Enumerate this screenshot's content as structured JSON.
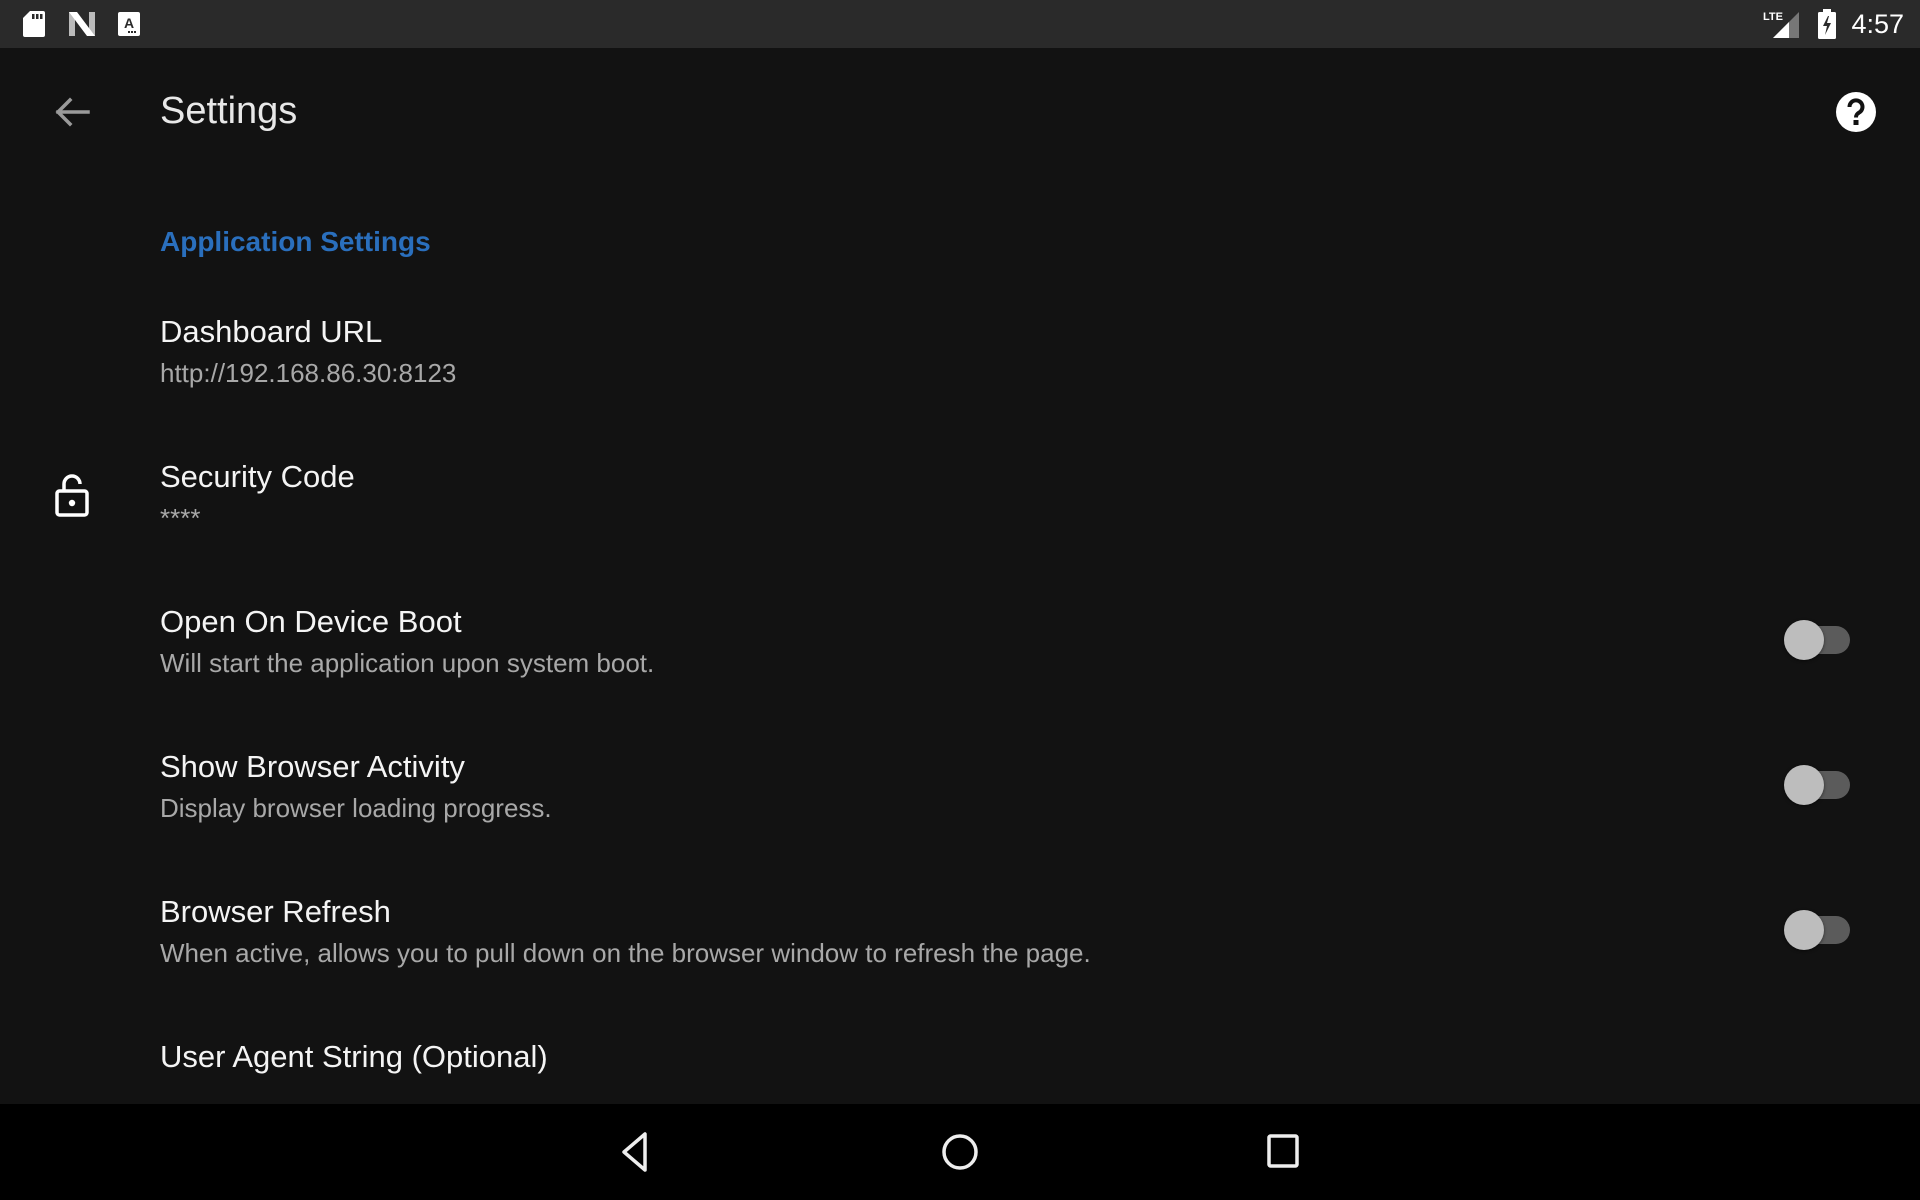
{
  "status_bar": {
    "left_icons": [
      "sd-card-icon",
      "nova-launcher-icon",
      "accessibility-a-icon"
    ],
    "network_label": "LTE",
    "right_icons": [
      "lte-signal-icon",
      "battery-charging-icon"
    ],
    "time": "4:57"
  },
  "app_bar": {
    "back_icon": "arrow-back-icon",
    "title": "Settings",
    "help_icon": "help-circle-icon"
  },
  "section": {
    "title": "Application Settings",
    "accent_color": "#2a6fbd"
  },
  "settings": [
    {
      "id": "dashboard-url",
      "title": "Dashboard URL",
      "summary": "http://192.168.86.30:8123",
      "icon": null,
      "toggle": null
    },
    {
      "id": "security-code",
      "title": "Security Code",
      "summary": "****",
      "icon": "lock-open-icon",
      "toggle": null
    },
    {
      "id": "open-on-boot",
      "title": "Open On Device Boot",
      "summary": "Will start the application upon system boot.",
      "icon": null,
      "toggle": false
    },
    {
      "id": "show-browser-activity",
      "title": "Show Browser Activity",
      "summary": "Display browser loading progress.",
      "icon": null,
      "toggle": false
    },
    {
      "id": "browser-refresh",
      "title": "Browser Refresh",
      "summary": "When active, allows you to pull down on the browser window to refresh the page.",
      "icon": null,
      "toggle": false
    },
    {
      "id": "user-agent",
      "title": "User Agent String (Optional)",
      "summary": "",
      "icon": null,
      "toggle": null
    }
  ],
  "nav_bar": {
    "buttons": [
      "nav-back-icon",
      "nav-home-icon",
      "nav-recents-icon"
    ]
  }
}
